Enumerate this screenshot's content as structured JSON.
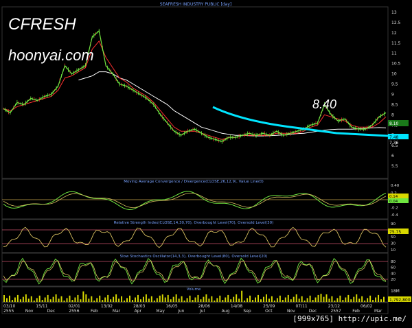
{
  "main_title": "SEAFRESH INDUSTRY PUBLIC [day]",
  "watermark": {
    "symbol": "CFRESH",
    "site": "hoonyai.com"
  },
  "annotation_price": "8.40",
  "price_axis": [
    "13",
    "12.5",
    "12",
    "11.5",
    "11",
    "10.5",
    "10",
    "9.5",
    "9",
    "8.5",
    "8",
    "7.5",
    "7",
    "6.5",
    "6",
    "5.5"
  ],
  "last_price_tag": "8.10",
  "ma_tags": [
    "7.48",
    "7.36"
  ],
  "macd": {
    "title": "Moving Average Convergence / Divergence(CLOSE,26,12,9), Value Line(0)",
    "axis": [
      "0.40",
      "0.2",
      "0",
      "-0.2",
      "-0.4"
    ],
    "tags": [
      "0.14",
      "0.04"
    ]
  },
  "rsi": {
    "title": "Relative Strength Index(CLOSE,14,30,70), Overbought Level(70), Oversold Level(30)",
    "axis": [
      "90",
      "70",
      "50",
      "30",
      "10"
    ],
    "tag": "75.75"
  },
  "stoch": {
    "title": "Slow Stochastics Oscillator(14,3,3), Overbought Level(80), Oversold Level(20)",
    "axis": [
      "80",
      "60",
      "40",
      "20"
    ]
  },
  "volume": {
    "title": "Volume",
    "axis": [
      "18M"
    ],
    "tag": "1,792,800"
  },
  "dates_row1": [
    "03/10",
    "15/11",
    "02/01",
    "13/02",
    "28/03",
    "16/05",
    "28/06",
    "14/08",
    "25/09",
    "07/11",
    "23/12",
    "06/02"
  ],
  "dates_row2": [
    "2555",
    "Nov",
    "Dec",
    "2556",
    "Feb",
    "Mar",
    "Apr",
    "May",
    "Jun",
    "Jul",
    "Aug",
    "Sep",
    "Oct",
    "Nov",
    "Dec",
    "2557",
    "Feb",
    "Mar"
  ],
  "footer": "[999x765] http://upic.me/",
  "colors": {
    "price": "#6fe640",
    "ma_short": "#ff3030",
    "ma_long": "#ffffff",
    "cyan": "#00e5ff",
    "level": "#c8a64b"
  },
  "chart_data": {
    "type": "line",
    "title": "SEAFRESH INDUSTRY PUBLIC [day]",
    "x": [
      0,
      10,
      20,
      30,
      40,
      50,
      60,
      70,
      80,
      90,
      100,
      110,
      120,
      130,
      140,
      150,
      160,
      170,
      180,
      190,
      200,
      210,
      220,
      230,
      240,
      250,
      260,
      270,
      280,
      290,
      300,
      310,
      320,
      330,
      340,
      350,
      360,
      370,
      380,
      390,
      400,
      410,
      420,
      430,
      440,
      450,
      460,
      470,
      480,
      490,
      500,
      510,
      520,
      530,
      540,
      550,
      560
    ],
    "series": [
      {
        "name": "CLOSE",
        "values": [
          8.3,
          8.1,
          8.6,
          8.5,
          8.8,
          8.7,
          8.9,
          9.0,
          9.4,
          10.4,
          10.0,
          10.2,
          10.4,
          11.8,
          12.1,
          10.4,
          10.0,
          9.5,
          9.4,
          9.2,
          9.0,
          8.8,
          8.5,
          8.0,
          7.6,
          7.2,
          7.0,
          7.2,
          7.3,
          7.1,
          6.9,
          6.8,
          6.7,
          6.9,
          6.9,
          7.0,
          7.1,
          7.0,
          7.1,
          7.0,
          7.2,
          7.0,
          7.1,
          7.2,
          7.3,
          7.5,
          7.6,
          8.5,
          8.0,
          7.7,
          7.8,
          7.4,
          7.3,
          7.3,
          7.5,
          7.9,
          8.1
        ]
      },
      {
        "name": "EMA-short",
        "values": [
          8.3,
          8.2,
          8.4,
          8.5,
          8.6,
          8.7,
          8.8,
          8.9,
          9.2,
          9.8,
          9.9,
          10.1,
          10.3,
          11.2,
          11.6,
          10.8,
          10.3,
          9.8,
          9.6,
          9.3,
          9.1,
          8.9,
          8.6,
          8.2,
          7.8,
          7.4,
          7.2,
          7.2,
          7.2,
          7.1,
          7.0,
          6.9,
          6.8,
          6.9,
          6.9,
          7.0,
          7.0,
          7.0,
          7.0,
          7.0,
          7.1,
          7.1,
          7.1,
          7.1,
          7.2,
          7.4,
          7.5,
          8.0,
          7.9,
          7.8,
          7.7,
          7.5,
          7.4,
          7.4,
          7.4,
          7.6,
          7.9
        ]
      },
      {
        "name": "EMA-long",
        "values": [
          null,
          null,
          null,
          null,
          null,
          null,
          null,
          null,
          null,
          null,
          null,
          9.7,
          9.8,
          9.9,
          10.1,
          10.1,
          10.0,
          9.8,
          9.7,
          9.5,
          9.3,
          9.1,
          8.9,
          8.7,
          8.5,
          8.2,
          8.0,
          7.8,
          7.6,
          7.4,
          7.3,
          7.2,
          7.1,
          7.05,
          7.0,
          7.0,
          6.98,
          6.97,
          6.97,
          6.98,
          7.0,
          7.02,
          7.05,
          7.08,
          7.1,
          7.15,
          7.2,
          7.25,
          7.28,
          7.3,
          7.3,
          7.3,
          7.32,
          7.34,
          7.36,
          7.38,
          7.36
        ]
      }
    ],
    "ylim": [
      5.5,
      13
    ],
    "legend": "none",
    "grid": false
  }
}
